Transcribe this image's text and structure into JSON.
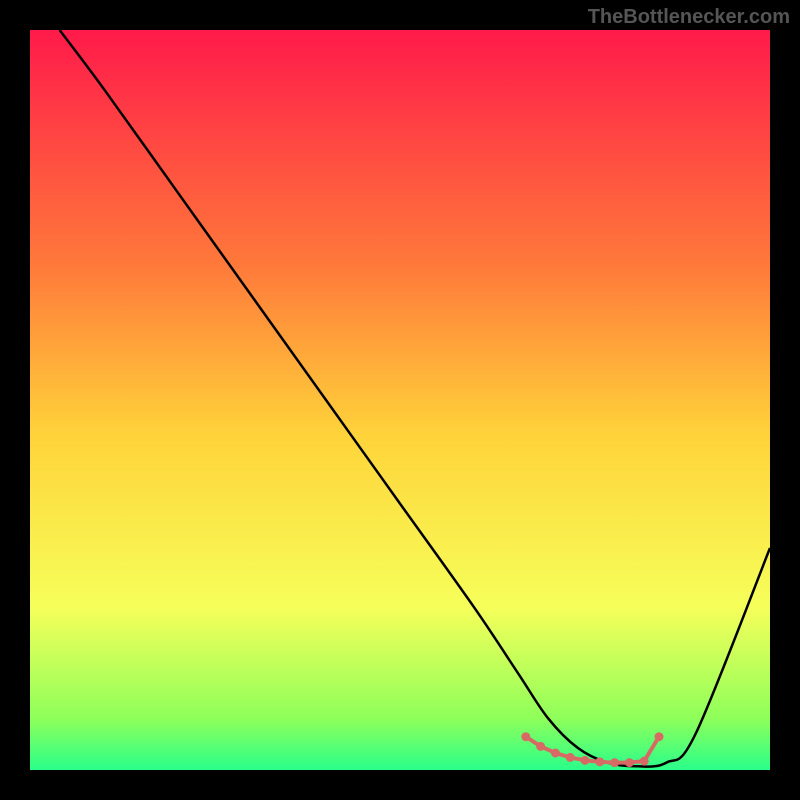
{
  "watermark": "TheBottlenecker.com",
  "chart_data": {
    "type": "line",
    "title": "",
    "xlabel": "",
    "ylabel": "",
    "xlim": [
      0,
      100
    ],
    "ylim": [
      0,
      100
    ],
    "grid": false,
    "legend": false,
    "gradient_stops": [
      {
        "offset": 0,
        "color": "#ff1a4a"
      },
      {
        "offset": 0.32,
        "color": "#ff7a3a"
      },
      {
        "offset": 0.55,
        "color": "#ffd43a"
      },
      {
        "offset": 0.78,
        "color": "#f6ff5a"
      },
      {
        "offset": 0.93,
        "color": "#8fff5a"
      },
      {
        "offset": 1.0,
        "color": "#2aff8a"
      }
    ],
    "series": [
      {
        "name": "curve",
        "type": "line",
        "color": "#000000",
        "x": [
          4,
          10,
          20,
          30,
          40,
          50,
          60,
          66,
          70,
          74,
          78,
          82,
          86,
          90,
          100
        ],
        "y": [
          100,
          92,
          78,
          64,
          50,
          36,
          22,
          13,
          7,
          3,
          1,
          0.5,
          1,
          5,
          30
        ]
      },
      {
        "name": "bottom-markers",
        "type": "scatter",
        "color": "#d86a66",
        "x": [
          67,
          69,
          71,
          73,
          75,
          77,
          79,
          81,
          83,
          85
        ],
        "y": [
          4.5,
          3.2,
          2.3,
          1.7,
          1.3,
          1.1,
          1.0,
          1.0,
          1.2,
          4.5
        ]
      }
    ]
  }
}
